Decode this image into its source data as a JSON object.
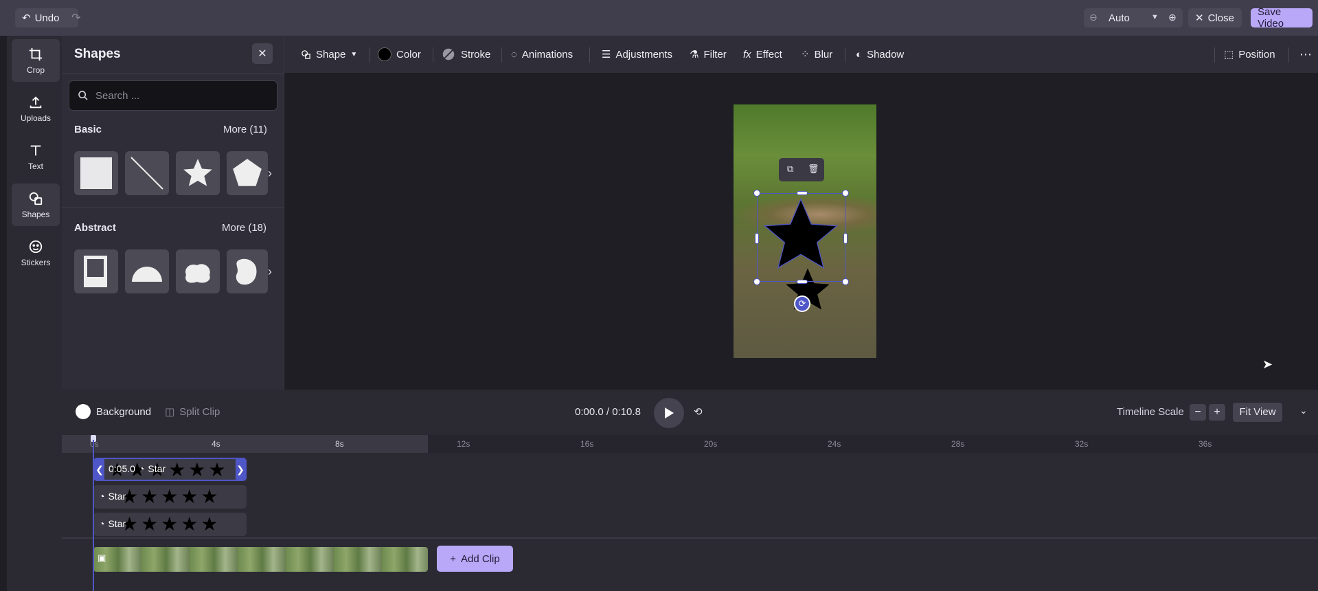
{
  "topbar": {
    "undo_label": "Undo",
    "zoom_value": "Auto",
    "close_label": "Close",
    "save_label": "Save Video"
  },
  "rail": {
    "items": [
      {
        "label": "Crop",
        "icon": "crop-icon"
      },
      {
        "label": "Uploads",
        "icon": "upload-icon"
      },
      {
        "label": "Text",
        "icon": "text-icon"
      },
      {
        "label": "Shapes",
        "icon": "shapes-icon"
      },
      {
        "label": "Stickers",
        "icon": "sticker-icon"
      }
    ]
  },
  "panel": {
    "title": "Shapes",
    "search_placeholder": "Search ...",
    "basic": {
      "title": "Basic",
      "more": "More (11)"
    },
    "abstract": {
      "title": "Abstract",
      "more": "More (18)"
    }
  },
  "toolbar": {
    "shape": "Shape",
    "color": "Color",
    "stroke": "Stroke",
    "animations": "Animations",
    "adjustments": "Adjustments",
    "filter": "Filter",
    "effect": "Effect",
    "blur": "Blur",
    "shadow": "Shadow",
    "position": "Position"
  },
  "timeline": {
    "background_label": "Background",
    "split_label": "Split Clip",
    "time": "0:00.0 / 0:10.8",
    "scale_label": "Timeline Scale",
    "fit_label": "Fit View",
    "ticks": [
      "0s",
      "4s",
      "8s",
      "12s",
      "16s",
      "20s",
      "24s",
      "28s",
      "32s",
      "36s"
    ],
    "clips": [
      {
        "label": "Star",
        "duration": "0:05.0"
      },
      {
        "label": "Star"
      },
      {
        "label": "Star"
      }
    ],
    "add_clip_label": "Add Clip"
  },
  "colors": {
    "accent": "#b9a8f7",
    "selection": "#4f56c8"
  }
}
